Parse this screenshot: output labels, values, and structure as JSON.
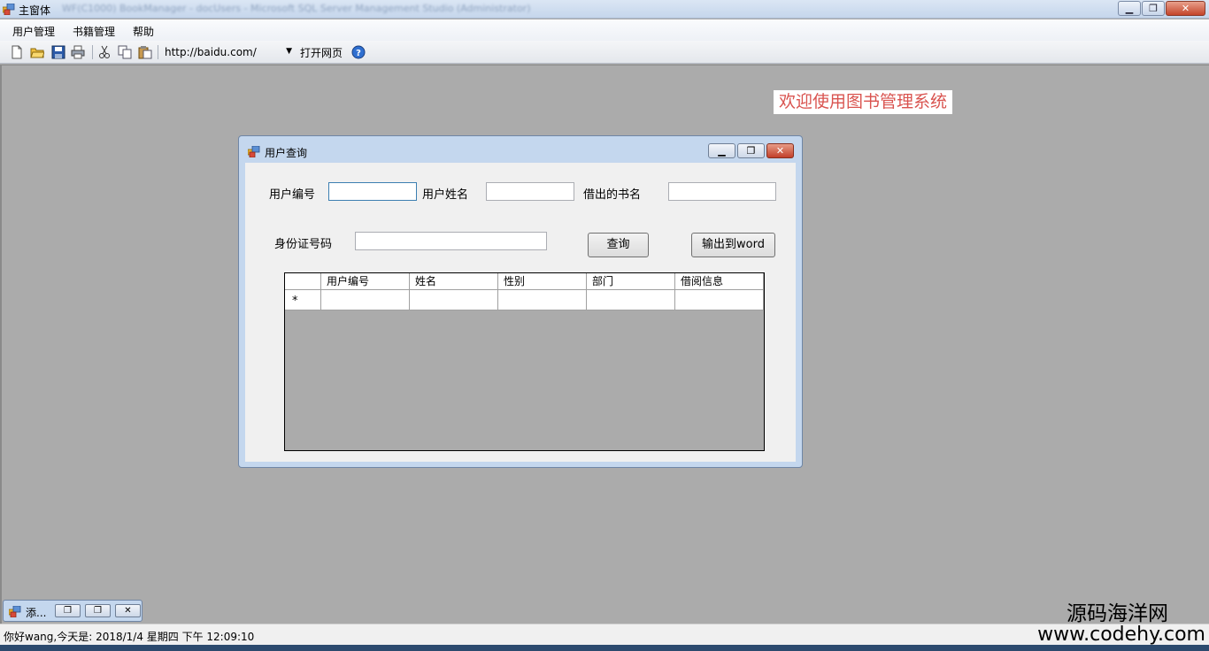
{
  "window": {
    "title": "主窗体",
    "title_background_text": "WF(C1000) BookManager - docUsers - Microsoft SQL Server Management Studio (Administrator)",
    "buttons": {
      "minimize": "▁",
      "maximize": "❐",
      "close": "✕"
    }
  },
  "menu": {
    "items": [
      "用户管理",
      "书籍管理",
      "帮助"
    ]
  },
  "toolbar": {
    "icons": [
      "new-icon",
      "open-icon",
      "save-icon",
      "print-icon",
      "cut-icon",
      "copy-icon",
      "paste-icon"
    ],
    "url_value": "http://baidu.com/",
    "open_page_label": "打开网页",
    "help_icon": "help-icon"
  },
  "welcome_text": "欢迎使用图书管理系统",
  "dialog": {
    "title": "用户查询",
    "labels": {
      "user_id": "用户编号",
      "user_name": "用户姓名",
      "book_name": "借出的书名",
      "id_number": "身份证号码"
    },
    "inputs": {
      "user_id": "",
      "user_name": "",
      "book_name": "",
      "id_number": ""
    },
    "query_button": "查询",
    "export_button": "输出到word",
    "grid": {
      "columns": [
        "用户编号",
        "姓名",
        "性别",
        "部门",
        "借阅信息"
      ],
      "new_row_marker": "*"
    }
  },
  "minimized_window": {
    "title": "添..."
  },
  "status": {
    "text": "你好wang,今天是:  2018/1/4 星期四 下午 12:09:10"
  },
  "watermark": {
    "line1": "源码海洋网",
    "line2": "www.codehy.com"
  }
}
